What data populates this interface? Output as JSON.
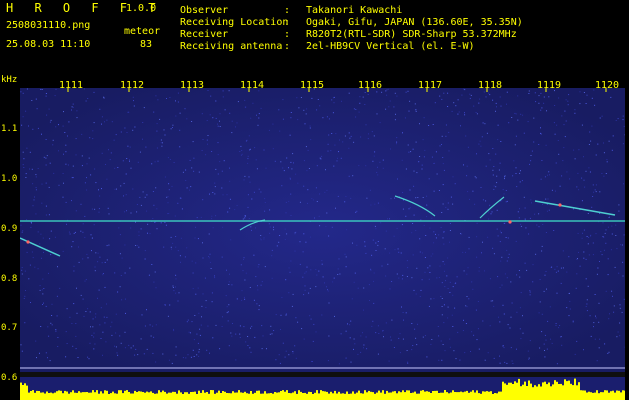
{
  "header": {
    "app_name": "H R O F F T",
    "version": "1.0.0",
    "filename": "2508031110.png",
    "meteor_label": "meteor",
    "timestamp": "25.08.03 11:10",
    "meteor_count": "83"
  },
  "info": [
    {
      "key": "Observer",
      "value": "Takanori Kawachi"
    },
    {
      "key": "Receiving Location",
      "value": "Ogaki, Gifu, JAPAN (136.60E, 35.35N)"
    },
    {
      "key": "Receiver",
      "value": "R820T2(RTL-SDR) SDR-Sharp 53.372MHz"
    },
    {
      "key": "Receiving antenna",
      "value": "2el-HB9CV Vertical (el. E-W)"
    }
  ],
  "axis": {
    "unit": "kHz",
    "y_ticks": [
      "1.1",
      "1.0",
      "0.9",
      "0.8",
      "0.7",
      "0.6"
    ],
    "x_ticks": [
      "1111",
      "1112",
      "1113",
      "1114",
      "1115",
      "1116",
      "1117",
      "1118",
      "1119",
      "1120"
    ]
  },
  "colors": {
    "label": "#ffff00",
    "background": "#1a1e6e",
    "carrier": "#3ed6c8",
    "bottom_bar": "#ffff00"
  }
}
